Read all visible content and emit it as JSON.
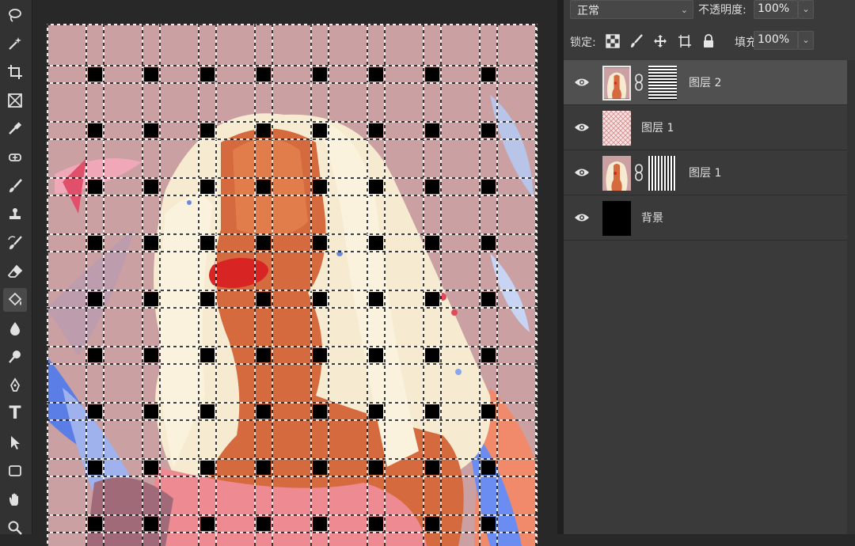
{
  "blend": {
    "mode": "正常",
    "opacity_label": "不透明度:",
    "opacity_value": "100%"
  },
  "lock": {
    "label": "锁定:",
    "fill_label": "填充:",
    "fill_value": "100%"
  },
  "layers": [
    {
      "name": "图层 2",
      "selected": true,
      "thumb": "portrait",
      "mask": "horizontal-stripes"
    },
    {
      "name": "图层 1",
      "selected": false,
      "thumb": "pattern",
      "mask": null
    },
    {
      "name": "图层 1",
      "selected": false,
      "thumb": "portrait",
      "mask": "vertical-stripes"
    },
    {
      "name": "背景",
      "selected": false,
      "thumb": "black",
      "mask": null
    }
  ],
  "tools": [
    "lasso-icon",
    "magic-wand-icon",
    "crop-icon",
    "frame-icon",
    "eyedropper-icon",
    "healing-brush-icon",
    "brush-icon",
    "clone-stamp-icon",
    "history-brush-icon",
    "eraser-icon",
    "paint-bucket-icon",
    "blur-icon",
    "dodge-icon",
    "pen-icon",
    "type-icon",
    "path-selection-icon",
    "rectangle-icon",
    "hand-icon",
    "zoom-icon"
  ],
  "type_tool_glyph": "T",
  "colors": {
    "canvas_bg": "#caa0a3",
    "panel": "#3a3a3a",
    "selected_layer": "#505050"
  }
}
